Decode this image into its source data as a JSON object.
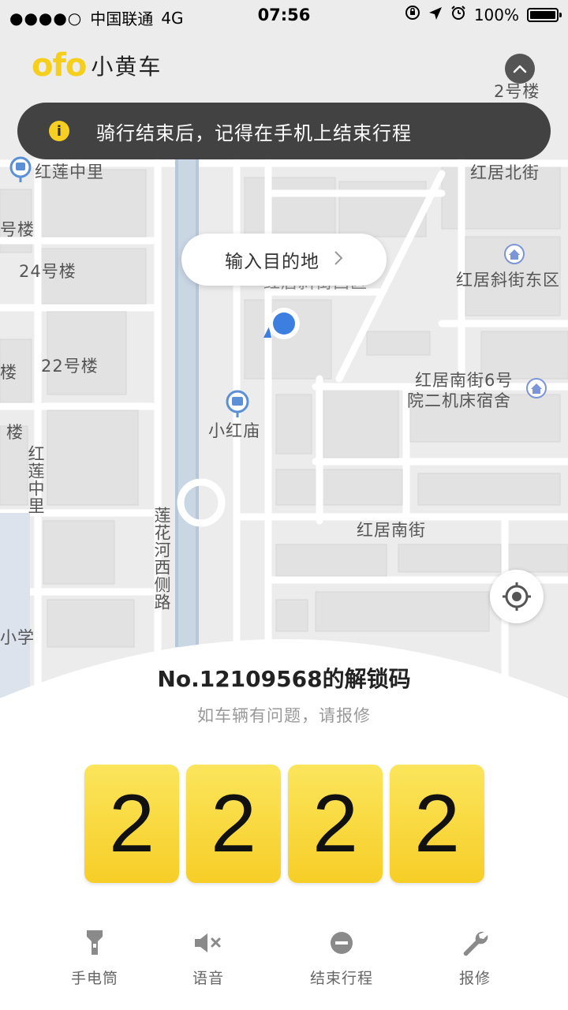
{
  "status_bar": {
    "signal": "●●●●○",
    "carrier": "中国联通",
    "network": "4G",
    "time": "07:56",
    "battery_text": "100%",
    "battery_level": 1.0
  },
  "header": {
    "logo_text": "ofo",
    "app_name": "小黄车",
    "logo_color": "#f5cf1c"
  },
  "banner": {
    "icon": "info-icon",
    "icon_glyph": "i",
    "text": "骑行结束后，记得在手机上结束行程"
  },
  "destination": {
    "label": "输入目的地",
    "icon": "chevron-right-icon"
  },
  "map_labels": {
    "building_2": "2号楼",
    "honglian_zhongli": "红莲中里",
    "hongju_beijie": "红居北街",
    "building_left": "号楼",
    "building_24": "24号楼",
    "hongju_xiejie_west": "红居斜街西区",
    "hongju_xiejie_east": "红居斜街东区",
    "building_22": "22号楼",
    "hongju_nanjie_6": "红居南街6号",
    "hongju_nanjie_6b": "院二机床宿舍",
    "bus_stop_xiaohongmiao": "小红庙",
    "building_edge1": "楼",
    "building_edge2": "楼",
    "honglian_zhongli_vertical": "红莲中里",
    "hongju_nanjie": "红居南街",
    "lianhuahe_west_road": "莲花河西侧路",
    "school_edge": "小学"
  },
  "unlock": {
    "title": "No.12109568的解锁码",
    "subtitle": "如车辆有问题，请报修",
    "digits": [
      "2",
      "2",
      "2",
      "2"
    ],
    "digit_color": "#f9d83a"
  },
  "toolbar": {
    "flashlight_label": "手电筒",
    "voice_label": "语音",
    "end_trip_label": "结束行程",
    "repair_label": "报修"
  }
}
